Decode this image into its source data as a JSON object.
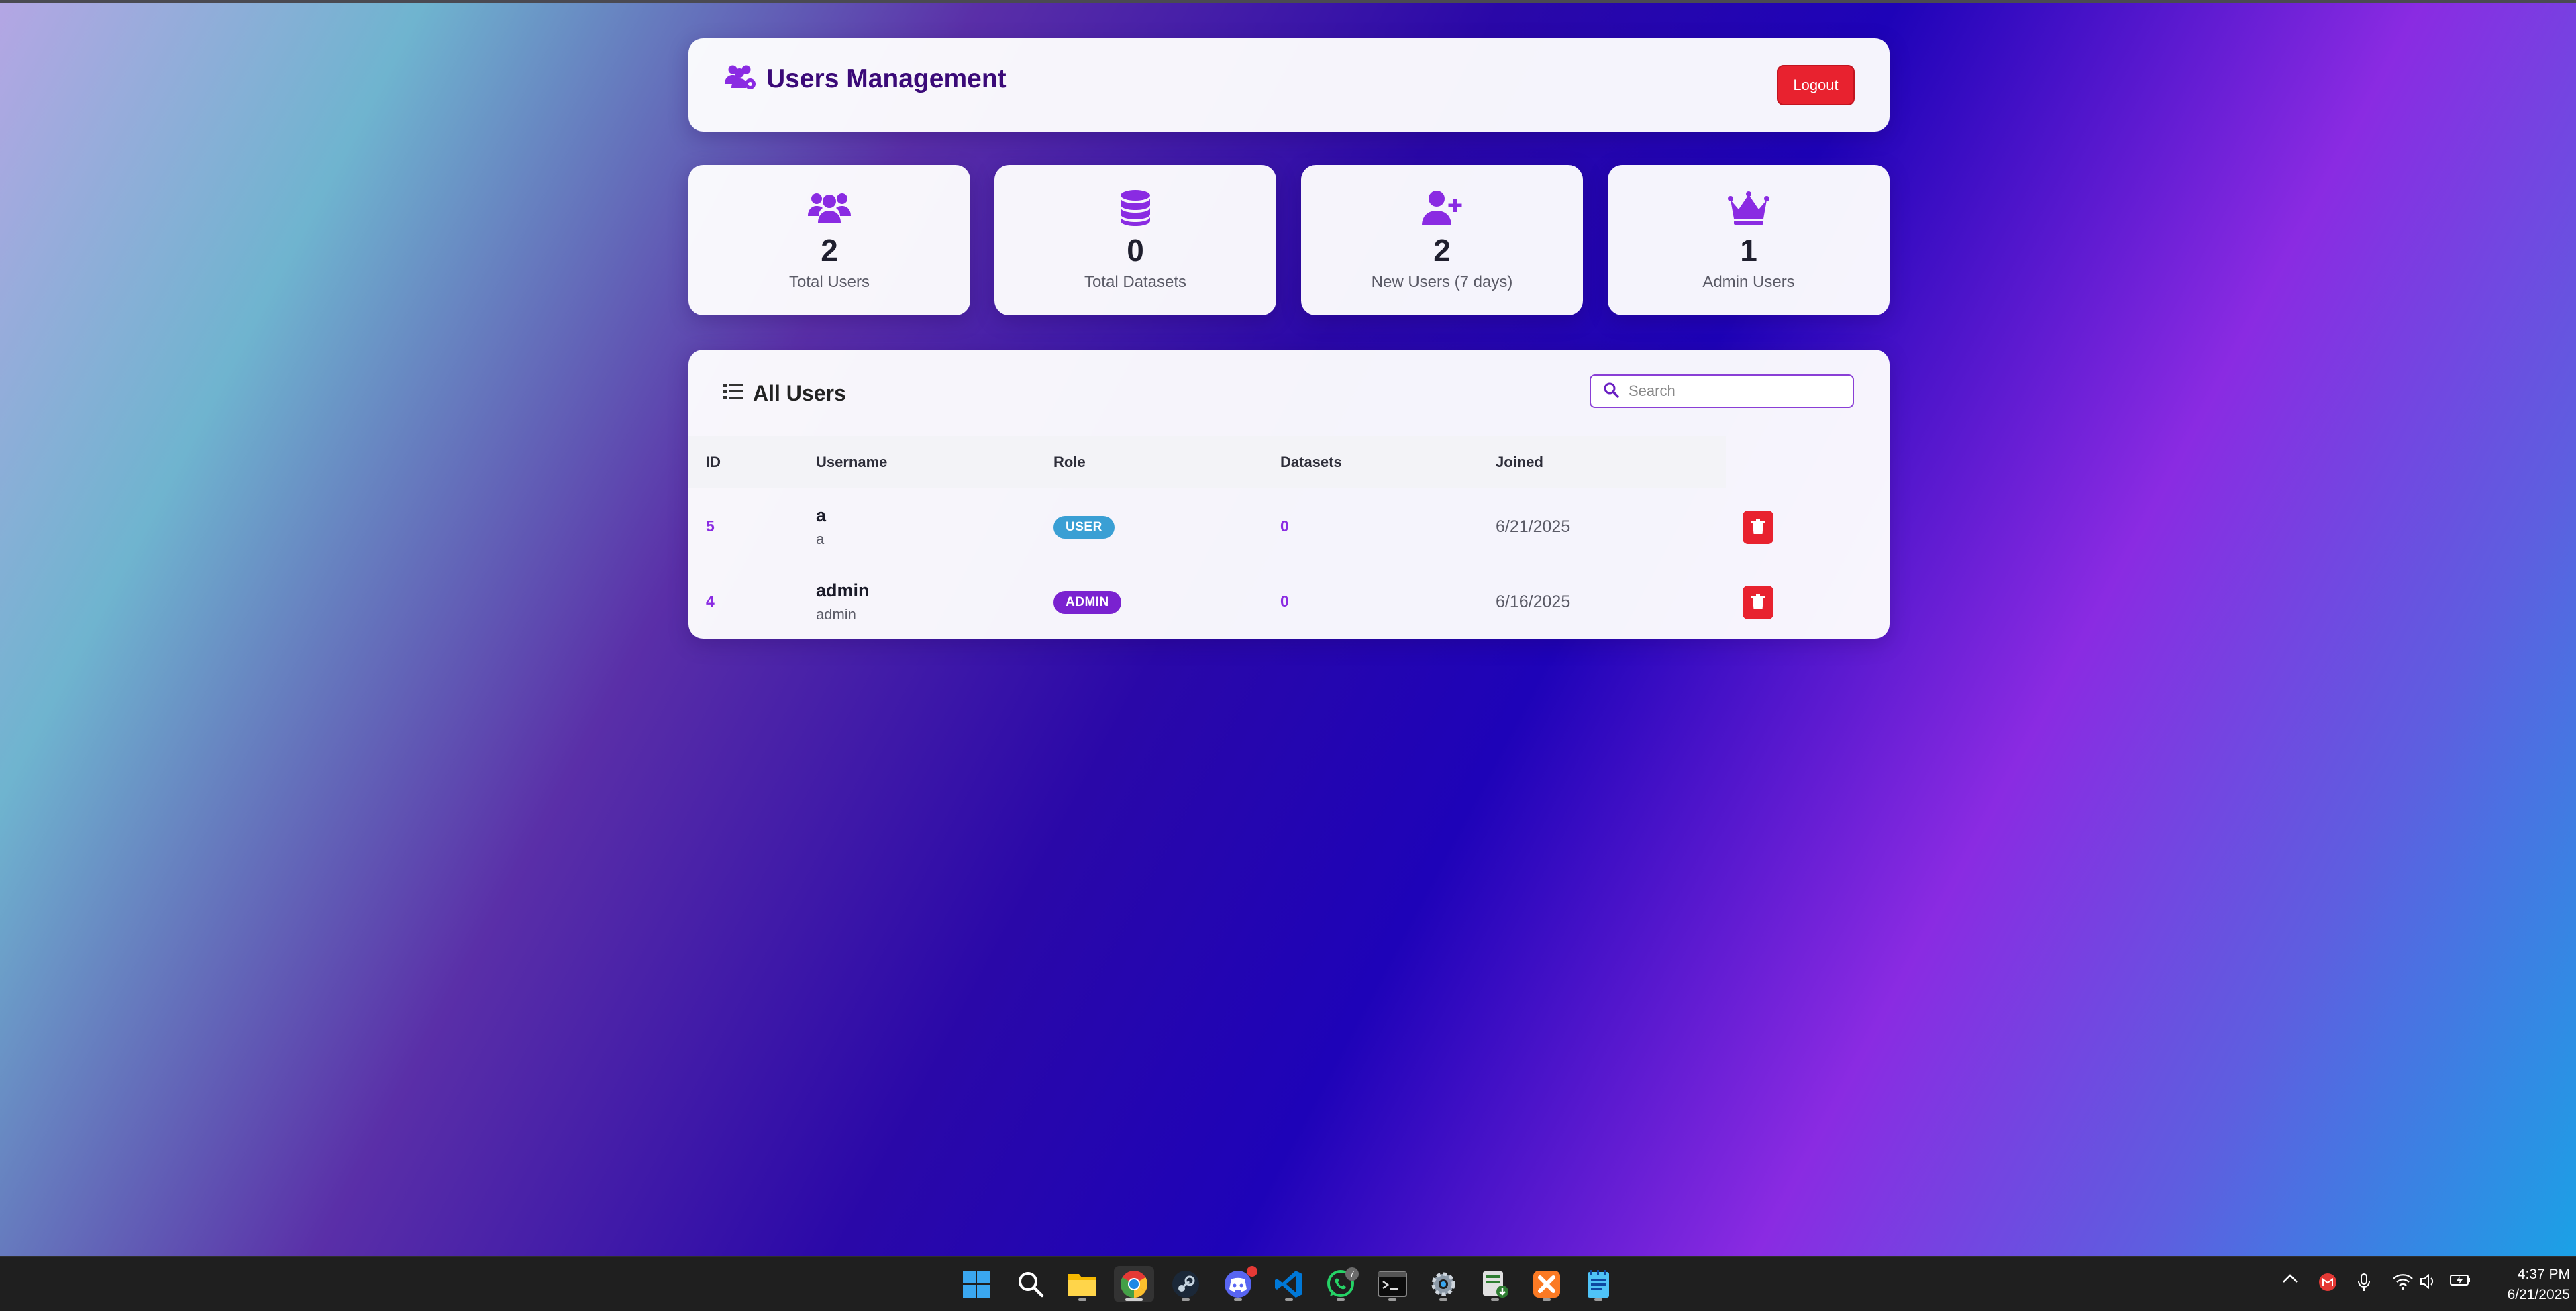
{
  "header": {
    "title": "Users Management",
    "logout_label": "Logout",
    "icon": "users-cog-icon"
  },
  "stats": [
    {
      "icon": "users-icon",
      "value": "2",
      "label": "Total Users"
    },
    {
      "icon": "database-icon",
      "value": "0",
      "label": "Total Datasets"
    },
    {
      "icon": "user-plus-icon",
      "value": "2",
      "label": "New Users (7 days)"
    },
    {
      "icon": "crown-icon",
      "value": "1",
      "label": "Admin Users"
    }
  ],
  "users_panel": {
    "title": "All Users",
    "icon": "list-icon",
    "search": {
      "placeholder": "Search",
      "value": ""
    },
    "columns": [
      "ID",
      "Username",
      "Role",
      "Datasets",
      "Joined"
    ],
    "rows": [
      {
        "id": "5",
        "username": "a",
        "sub": "a",
        "role": "USER",
        "datasets": "0",
        "joined": "6/21/2025"
      },
      {
        "id": "4",
        "username": "admin",
        "sub": "admin",
        "role": "ADMIN",
        "datasets": "0",
        "joined": "6/16/2025"
      }
    ]
  },
  "colors": {
    "accent": "#8a2be2",
    "danger": "#e8222f",
    "title": "#3b0a78",
    "user_badge": "#3a9fd4",
    "admin_badge": "#7a22d0"
  },
  "taskbar": {
    "apps": [
      "windows-start-icon",
      "search-icon",
      "file-explorer-icon",
      "chrome-icon",
      "steam-icon",
      "discord-icon",
      "vscode-icon",
      "whatsapp-icon",
      "terminal-icon",
      "settings-icon",
      "app-installer-icon",
      "xampp-icon",
      "notepad-icon"
    ],
    "whatsapp_badge": "7",
    "time": "4:37 PM",
    "date": "6/21/2025"
  }
}
